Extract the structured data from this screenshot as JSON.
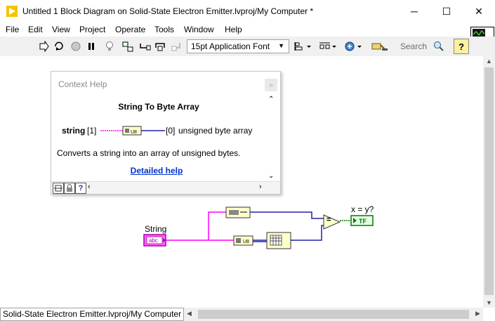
{
  "window": {
    "title": "Untitled 1 Block Diagram on Solid-State Electron Emitter.lvproj/My Computer *",
    "minimize": "─",
    "maximize": "☐",
    "close": "✕"
  },
  "menu": {
    "items": [
      "File",
      "Edit",
      "View",
      "Project",
      "Operate",
      "Tools",
      "Window",
      "Help"
    ]
  },
  "toolbar": {
    "font_select": "15pt Application Font",
    "search_placeholder": "Search"
  },
  "context_help": {
    "header": "Context Help",
    "function_name": "String To Byte Array",
    "input_terminal": "string",
    "input_index": "[1]",
    "output_index": "[0]",
    "output_terminal": "unsigned byte array",
    "description": "Converts a string into an array of unsigned bytes.",
    "link": "Detailed help"
  },
  "diagram": {
    "string_label": "String",
    "string_terminal_text": "abc",
    "indicator_label": "x = y?",
    "indicator_text": "TF",
    "equal_glyph": "="
  },
  "status": {
    "path": "Solid-State Electron Emitter.lvproj/My Computer"
  },
  "colors": {
    "string_wire": "#ff00ff",
    "array_wire": "#2222aa",
    "boolean_wire": "#007a00",
    "node_fill": "#ffffcc"
  }
}
